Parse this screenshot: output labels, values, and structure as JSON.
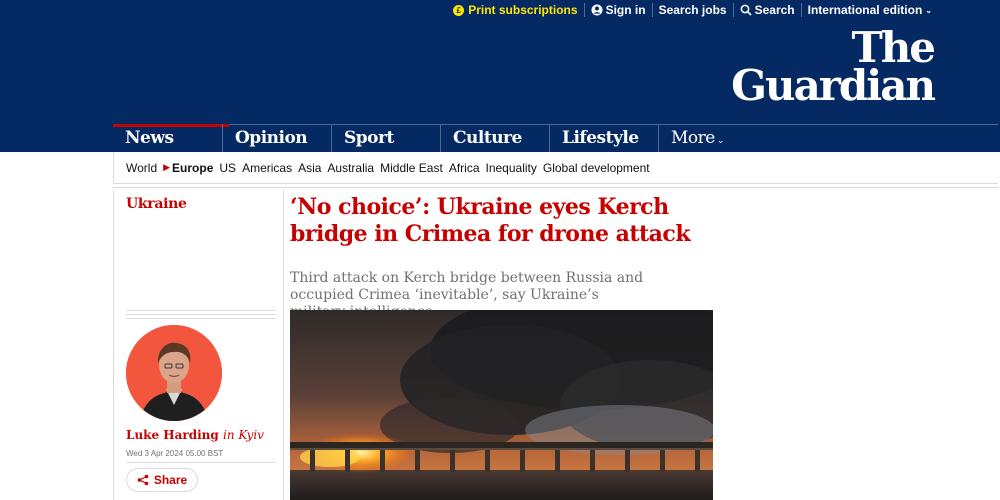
{
  "topbar": {
    "print_subscriptions": "Print subscriptions",
    "sign_in": "Sign in",
    "search_jobs": "Search jobs",
    "search": "Search",
    "edition": "International edition"
  },
  "logo": {
    "line1": "The",
    "line2": "Guardian"
  },
  "pillars": {
    "news": "News",
    "opinion": "Opinion",
    "sport": "Sport",
    "culture": "Culture",
    "lifestyle": "Lifestyle",
    "more": "More"
  },
  "subnav": {
    "items": [
      "World",
      "Europe",
      "US",
      "Americas",
      "Asia",
      "Australia",
      "Middle East",
      "Africa",
      "Inequality",
      "Global development"
    ],
    "current": "Europe"
  },
  "article": {
    "section": "Ukraine",
    "headline": "‘No choice’: Ukraine eyes Kerch bridge in Crimea for drone attack",
    "standfirst": "Third attack on Kerch bridge between Russia and occupied Crimea ‘inevitable’, say Ukraine’s military intelligence",
    "author": "Luke Harding",
    "location": "in Kyiv",
    "date": "Wed 3 Apr 2024 05.00 BST",
    "share_label": "Share"
  },
  "colors": {
    "brand": "#052962",
    "news_red": "#c70000",
    "print_yellow": "#ffe500",
    "avatar_bg": "#f2573d"
  },
  "icons": {
    "print": "coin-icon",
    "sign_in": "user-icon",
    "search": "search-icon",
    "edition": "chevron-down-icon",
    "share": "share-icon"
  }
}
